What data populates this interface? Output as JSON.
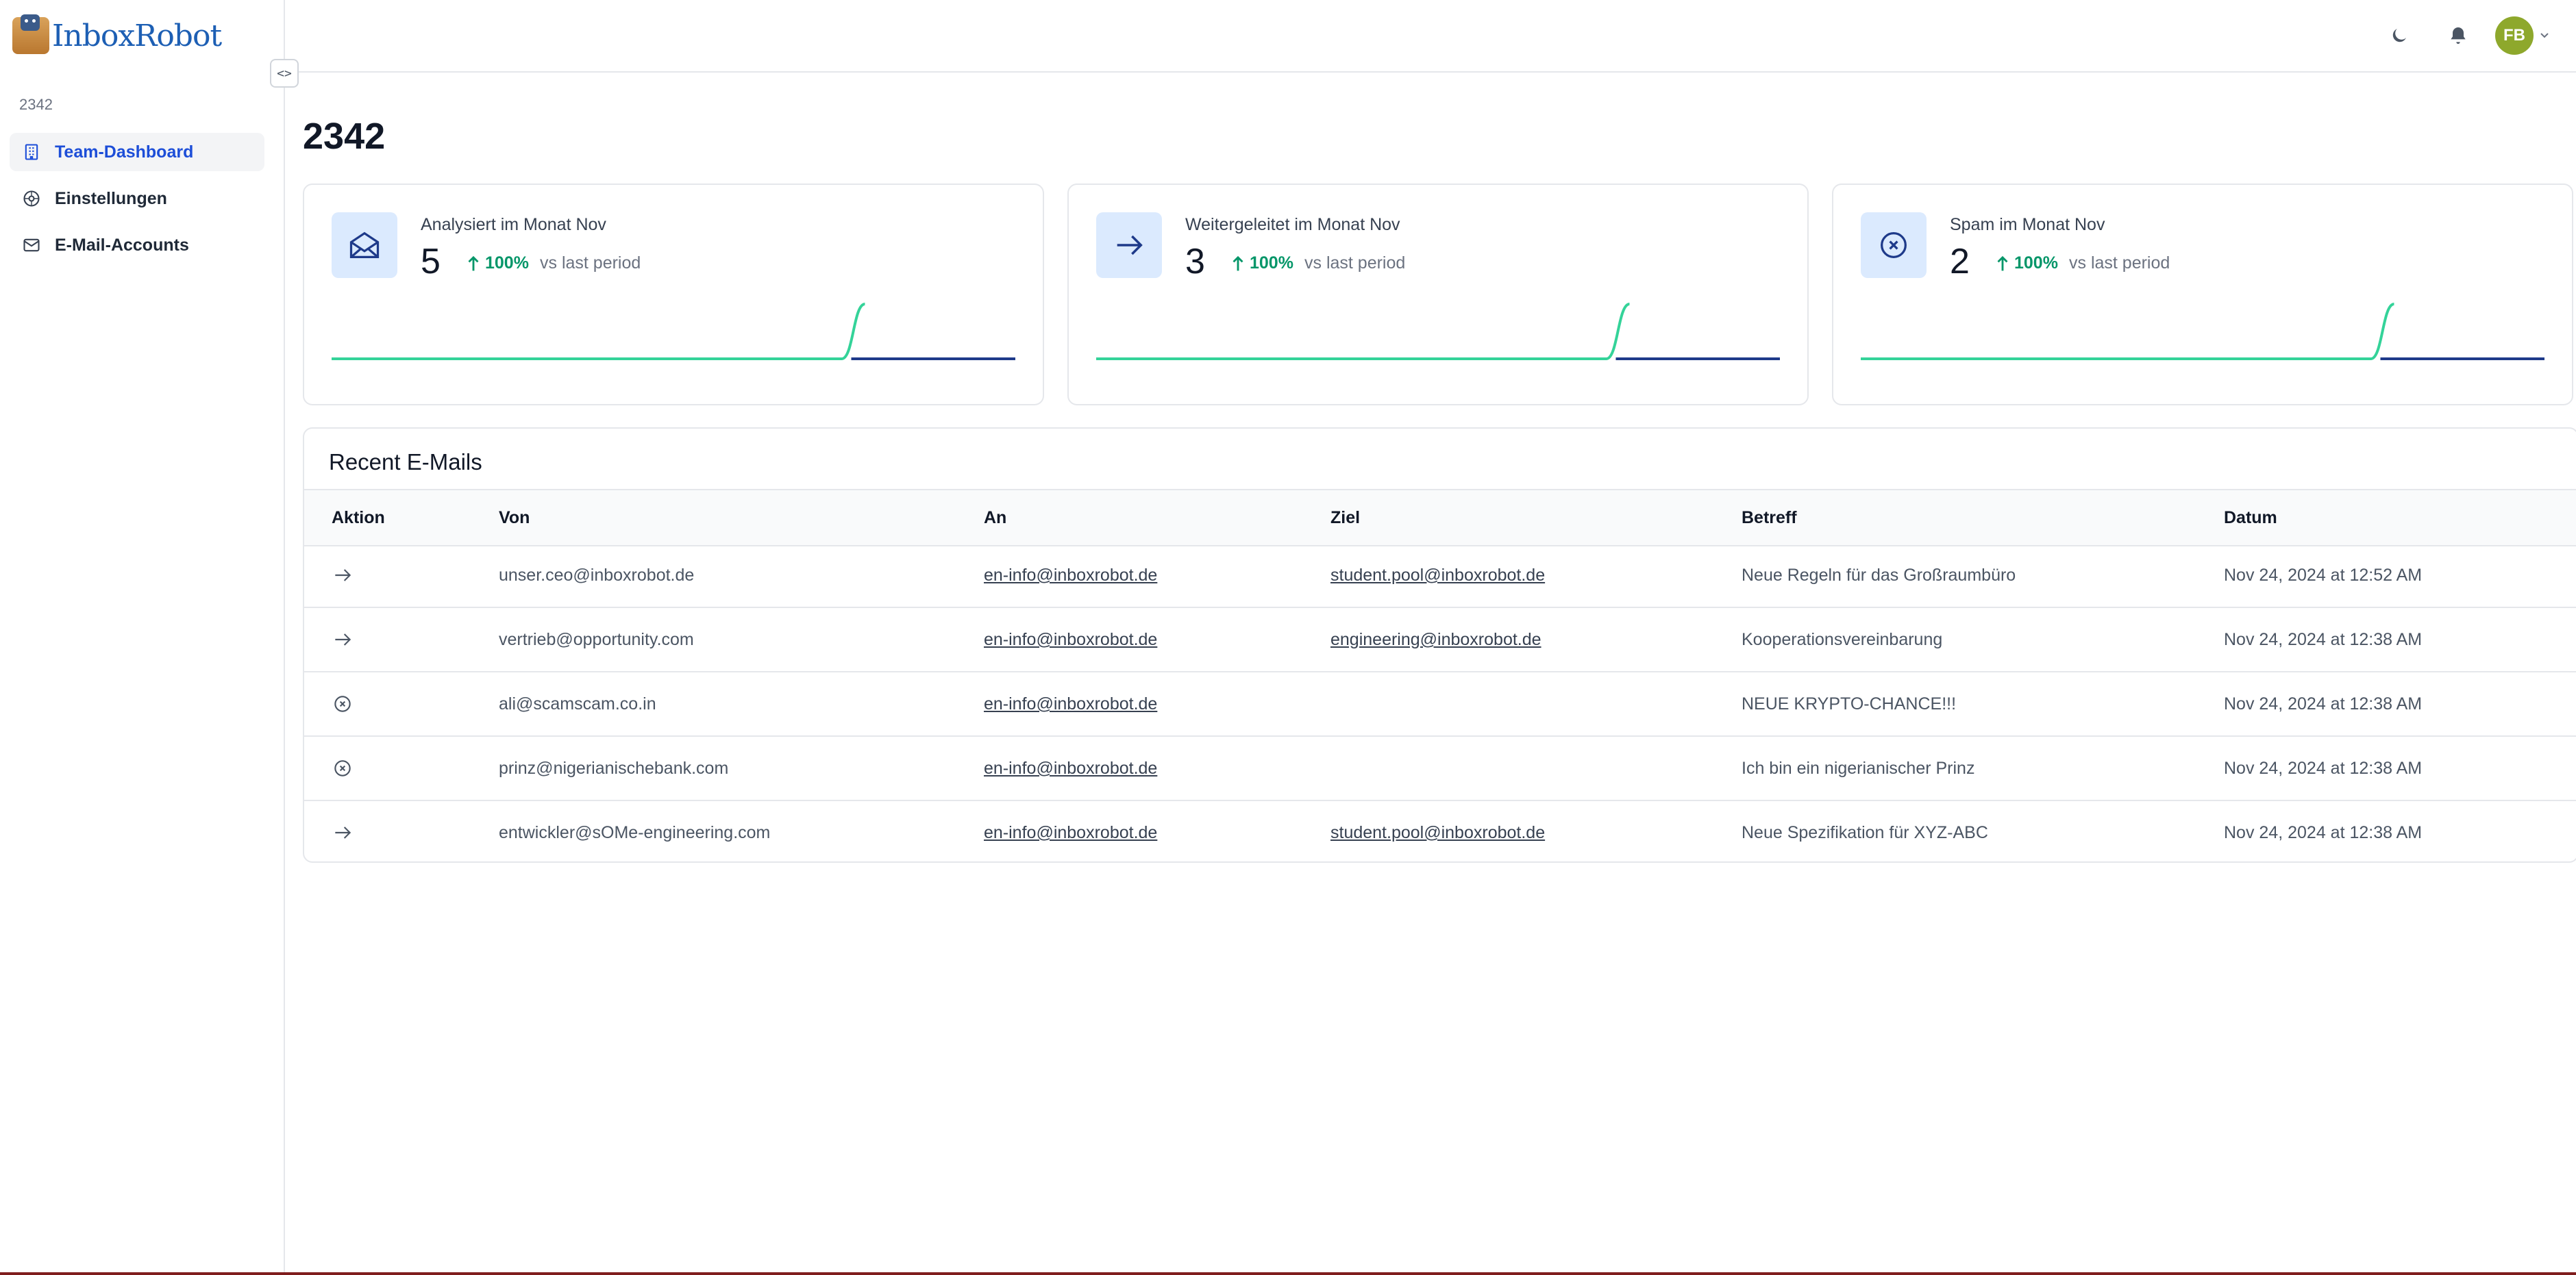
{
  "app": {
    "logo_text": "InboxRobot"
  },
  "sidebar": {
    "team_label": "2342",
    "items": [
      {
        "label": "Team-Dashboard",
        "icon": "building-icon",
        "active": true
      },
      {
        "label": "Einstellungen",
        "icon": "settings-icon",
        "active": false
      },
      {
        "label": "E-Mail-Accounts",
        "icon": "mail-icon",
        "active": false
      }
    ]
  },
  "header": {
    "avatar_initials": "FB",
    "theme_icon": "moon-icon",
    "notification_icon": "bell-icon"
  },
  "main": {
    "title": "2342",
    "stats": [
      {
        "label": "Analysiert im Monat Nov",
        "value": "5",
        "change": "100%",
        "compare": "vs last period",
        "icon": "mail-open-icon",
        "trend": [
          0,
          0,
          0,
          0,
          0,
          0,
          0,
          0,
          0,
          0,
          0,
          0,
          0,
          0,
          0,
          0,
          0,
          0,
          0,
          0,
          0,
          0,
          0,
          5
        ]
      },
      {
        "label": "Weitergeleitet im Monat Nov",
        "value": "3",
        "change": "100%",
        "compare": "vs last period",
        "icon": "arrow-right-icon",
        "trend": [
          0,
          0,
          0,
          0,
          0,
          0,
          0,
          0,
          0,
          0,
          0,
          0,
          0,
          0,
          0,
          0,
          0,
          0,
          0,
          0,
          0,
          0,
          0,
          3
        ]
      },
      {
        "label": "Spam im Monat Nov",
        "value": "2",
        "change": "100%",
        "compare": "vs last period",
        "icon": "x-circle-icon",
        "trend": [
          0,
          0,
          0,
          0,
          0,
          0,
          0,
          0,
          0,
          0,
          0,
          0,
          0,
          0,
          0,
          0,
          0,
          0,
          0,
          0,
          0,
          0,
          0,
          2
        ]
      }
    ],
    "recent": {
      "title": "Recent E-Mails",
      "columns": [
        "Aktion",
        "Von",
        "An",
        "Ziel",
        "Betreff",
        "Datum"
      ],
      "rows": [
        {
          "action": "forward",
          "von": "unser.ceo@inboxrobot.de",
          "an": "en-info@inboxrobot.de",
          "ziel": "student.pool@inboxrobot.de",
          "betreff": "Neue Regeln für das Großraumbüro",
          "datum": "Nov 24, 2024 at 12:52 AM"
        },
        {
          "action": "forward",
          "von": "vertrieb@opportunity.com",
          "an": "en-info@inboxrobot.de",
          "ziel": "engineering@inboxrobot.de",
          "betreff": "Kooperationsvereinbarung",
          "datum": "Nov 24, 2024 at 12:38 AM"
        },
        {
          "action": "spam",
          "von": "ali@scamscam.co.in",
          "an": "en-info@inboxrobot.de",
          "ziel": "",
          "betreff": "NEUE KRYPTO-CHANCE!!!",
          "datum": "Nov 24, 2024 at 12:38 AM"
        },
        {
          "action": "spam",
          "von": "prinz@nigerianischebank.com",
          "an": "en-info@inboxrobot.de",
          "ziel": "",
          "betreff": "Ich bin ein nigerianischer Prinz",
          "datum": "Nov 24, 2024 at 12:38 AM"
        },
        {
          "action": "forward",
          "von": "entwickler@sOMe-engineering.com",
          "an": "en-info@inboxrobot.de",
          "ziel": "student.pool@inboxrobot.de",
          "betreff": "Neue Spezifikation für XYZ-ABC",
          "datum": "Nov 24, 2024 at 12:38 AM"
        }
      ]
    }
  },
  "colors": {
    "accent": "#1d4ed8",
    "positive": "#059669",
    "chart_line": "#34d399",
    "chart_base": "#1e3a8a",
    "icon_bg": "#dbeafe"
  }
}
